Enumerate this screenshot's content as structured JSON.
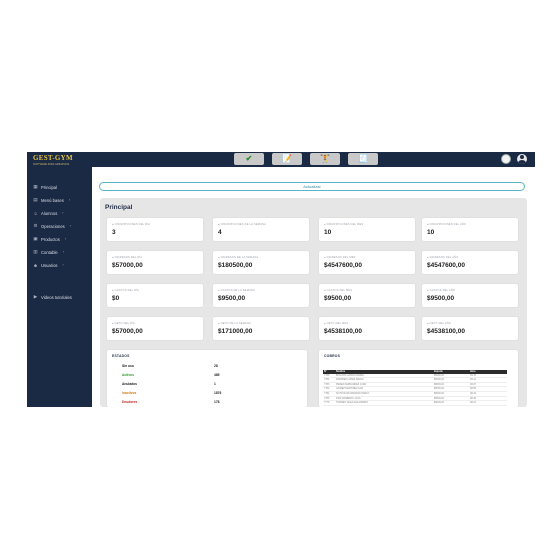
{
  "app": {
    "logo": "GEST-GYM",
    "logo_sub": "SOFTWARE PARA GIMNASIOS"
  },
  "topbar": {
    "buttons": [
      {
        "icon": "check-icon",
        "glyph": "✔"
      },
      {
        "icon": "clipboard-icon",
        "glyph": "📝"
      },
      {
        "icon": "weightlifter-icon",
        "glyph": "🏋"
      },
      {
        "icon": "cash-register-icon",
        "glyph": "🧾"
      }
    ]
  },
  "sidebar": {
    "items": [
      {
        "label": "Principal",
        "icon": "grid-icon",
        "glyph": "▦"
      },
      {
        "label": "Menú bases",
        "icon": "folder-icon",
        "glyph": "▤",
        "chevron": "›"
      },
      {
        "label": "Alumnos",
        "icon": "users-icon",
        "glyph": "☺",
        "chevron": "›"
      },
      {
        "label": "Operaciones",
        "icon": "gears-icon",
        "glyph": "⚙",
        "chevron": "›"
      },
      {
        "label": "Productos",
        "icon": "box-icon",
        "glyph": "▣",
        "chevron": "›"
      },
      {
        "label": "Contable",
        "icon": "calculator-icon",
        "glyph": "▥",
        "chevron": "›"
      },
      {
        "label": "Usuarios",
        "icon": "user-icon",
        "glyph": "☻",
        "chevron": "›"
      },
      {
        "label": "Videos tutoriales",
        "icon": "video-icon",
        "glyph": "▶"
      }
    ]
  },
  "main": {
    "update_button": "Actualizar",
    "title": "Principal",
    "cards": [
      {
        "label": "● INSCRIPCIONES DEL DÍA",
        "value": "3"
      },
      {
        "label": "● INSCRIPCIONES DE LA SEMANA",
        "value": "4"
      },
      {
        "label": "● INSCRIPCIONES DEL MES",
        "value": "10"
      },
      {
        "label": "● INSCRIPCIONES DEL AÑO",
        "value": "10"
      },
      {
        "label": "● INGRESOS DEL DÍA",
        "value": "$57000,00"
      },
      {
        "label": "● INGRESOS DE LA SEMANA",
        "value": "$180500,00"
      },
      {
        "label": "● INGRESOS DEL MES",
        "value": "$4547600,00"
      },
      {
        "label": "● INGRESOS DEL AÑO",
        "value": "$4547600,00"
      },
      {
        "label": "● GASTOS DEL DÍA",
        "value": "$0"
      },
      {
        "label": "● GASTOS DE LA SEMANA",
        "value": "$9500,00"
      },
      {
        "label": "● GASTOS DEL MES",
        "value": "$9500,00"
      },
      {
        "label": "● GASTOS DEL AÑO",
        "value": "$9500,00"
      },
      {
        "label": "● NETO DEL DÍA",
        "value": "$57000,00"
      },
      {
        "label": "● NETO DE LA SEMANA",
        "value": "$171000,00"
      },
      {
        "label": "● NETO DEL MES",
        "value": "$4538100,00"
      },
      {
        "label": "● NETO DEL AÑO",
        "value": "$4538100,00"
      }
    ],
    "estados": {
      "title": "ESTADOS",
      "rows": [
        {
          "label": "Sin uso",
          "value": "28",
          "color": "#222222"
        },
        {
          "label": "Activos",
          "value": "485",
          "color": "#2e9a2e"
        },
        {
          "label": "Anulados",
          "value": "1",
          "color": "#222222"
        },
        {
          "label": "Inactivos",
          "value": "1876",
          "color": "#d07a10"
        },
        {
          "label": "Deudores",
          "value": "178",
          "color": "#c0281e"
        }
      ]
    },
    "cobros": {
      "title": "COBROS",
      "columns": [
        "Nº",
        "Nombre",
        "Importe",
        "Hora"
      ],
      "rows": [
        [
          "7785",
          "BOUJON GARCIA MARIA",
          "$5000,00",
          "09:15"
        ],
        [
          "7784",
          "RAMIREZ LOPEZ DIEGO",
          "$5000,00",
          "09:12"
        ],
        [
          "7783",
          "PEREZ FERNANDEZ JUAN",
          "$9500,00",
          "09:07"
        ],
        [
          "7782",
          "GOMEZ MARTINEZ ANA",
          "$5000,00",
          "08:58"
        ],
        [
          "7781",
          "SOTO RUIZ MARIANO PABLO",
          "$5000,00",
          "08:44"
        ],
        [
          "7780",
          "DIAZ ROMERO LUCIA",
          "$9500,00",
          "08:36"
        ],
        [
          "7779",
          "TORRES VEGA ALEJANDRO",
          "$5000,00",
          "08:21"
        ]
      ]
    }
  }
}
